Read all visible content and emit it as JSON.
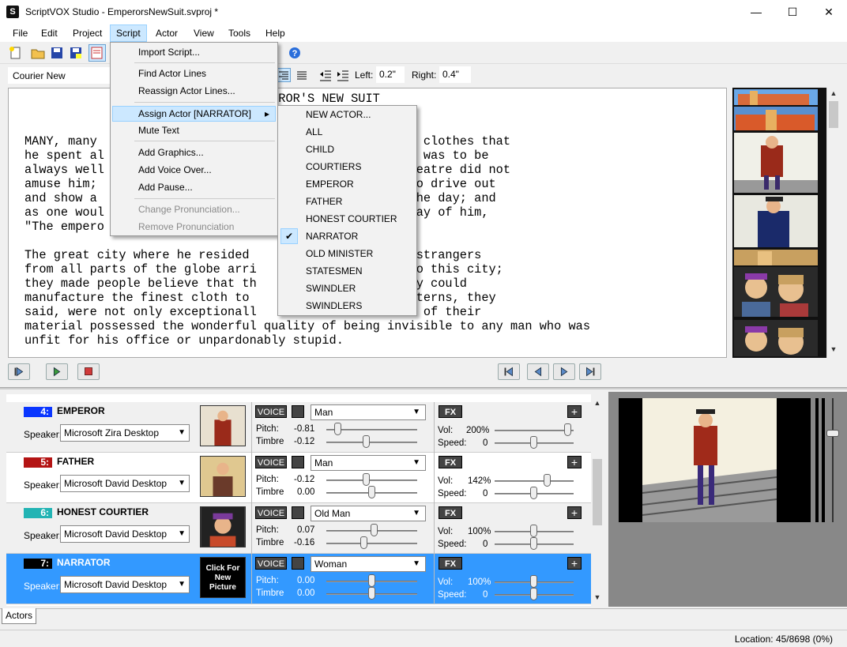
{
  "window": {
    "title": "ScriptVOX Studio - EmperorsNewSuit.svproj *",
    "app_icon": "S",
    "minimize": "—",
    "maximize": "☐",
    "close": "✕"
  },
  "menubar": [
    "File",
    "Edit",
    "Project",
    "Script",
    "Actor",
    "View",
    "Tools",
    "Help"
  ],
  "format": {
    "font": "Courier New",
    "left_label": "Left:",
    "left_value": "0.2\"",
    "right_label": "Right:",
    "right_value": "0.4\""
  },
  "editor": {
    "lines": [
      "                               EMPEROR'S NEW SUIT",
      "                                 en",
      "",
      "MANY, many                              so much of new clothes that",
      "he spent al                            s only ambition was to be",
      "always well                            ers, and the theatre did not",
      "amuse him;                             ything of was to drive out",
      "and show a                             every hour of the day; and",
      "as one woul                             so one could say of him,",
      "\"The empero",
      "",
      "The great city where he resided        every day many strangers",
      "from all parts of the globe arri       windlers came to this city;",
      "they made people believe that th       nd declared they could",
      "manufacture the finest cloth to        colours and patterns, they",
      "said, were not only exceptionall       he clothes made of their",
      "material possessed the wonderful quality of being invisible to any man who was",
      "unfit for his office or unpardonably stupid."
    ]
  },
  "script_menu": {
    "items": [
      "Import Script...",
      "Find Actor Lines",
      "Reassign Actor Lines...",
      "Assign Actor [NARRATOR]",
      "Mute Text",
      "Add Graphics...",
      "Add Voice Over...",
      "Add Pause...",
      "Change Pronunciation...",
      "Remove Pronunciation"
    ],
    "submenu_arrow": "▸"
  },
  "actor_submenu": {
    "items": [
      "NEW ACTOR...",
      "ALL",
      "CHILD",
      "COURTIERS",
      "EMPEROR",
      "FATHER",
      "HONEST COURTIER",
      "NARRATOR",
      "OLD MINISTER",
      "STATESMEN",
      "SWINDLER",
      "SWINDLERS"
    ],
    "checked": "NARRATOR",
    "check": "✔"
  },
  "actors": [
    {
      "num": "4:",
      "name": "EMPEROR",
      "color": "#0a36ff",
      "speaker_label": "Speaker:",
      "speaker": "Microsoft Zira Desktop",
      "voice_btn": "VOICE",
      "voice": "Man",
      "pitch_label": "Pitch:",
      "pitch": "-0.81",
      "timbre_label": "Timbre",
      "timbre": "-0.12",
      "fx": "FX",
      "vol_label": "Vol:",
      "vol": "200%",
      "speed_label": "Speed:",
      "speed": "0"
    },
    {
      "num": "5:",
      "name": "FATHER",
      "color": "#b41414",
      "speaker_label": "Speaker:",
      "speaker": "Microsoft David Desktop",
      "voice_btn": "VOICE",
      "voice": "Man",
      "pitch_label": "Pitch:",
      "pitch": "-0.12",
      "timbre_label": "Timbre",
      "timbre": "0.00",
      "fx": "FX",
      "vol_label": "Vol:",
      "vol": "142%",
      "speed_label": "Speed:",
      "speed": "0"
    },
    {
      "num": "6:",
      "name": "HONEST COURTIER",
      "color": "#22b4b4",
      "speaker_label": "Speaker:",
      "speaker": "Microsoft David Desktop",
      "voice_btn": "VOICE",
      "voice": "Old Man",
      "pitch_label": "Pitch:",
      "pitch": "0.07",
      "timbre_label": "Timbre",
      "timbre": "-0.16",
      "fx": "FX",
      "vol_label": "Vol:",
      "vol": "100%",
      "speed_label": "Speed:",
      "speed": "0"
    },
    {
      "num": "7:",
      "name": "NARRATOR",
      "color": "#000000",
      "speaker_label": "Speaker:",
      "speaker": "Microsoft David Desktop",
      "voice_btn": "VOICE",
      "voice": "Woman",
      "pitch_label": "Pitch:",
      "pitch": "0.00",
      "timbre_label": "Timbre",
      "timbre": "0.00",
      "fx": "FX",
      "vol_label": "Vol:",
      "vol": "100%",
      "speed_label": "Speed:",
      "speed": "0",
      "picture_text": "Click For New Picture"
    }
  ],
  "tabs": {
    "actors": "Actors"
  },
  "status": {
    "location": "Location: 45/8698 (0%)"
  }
}
